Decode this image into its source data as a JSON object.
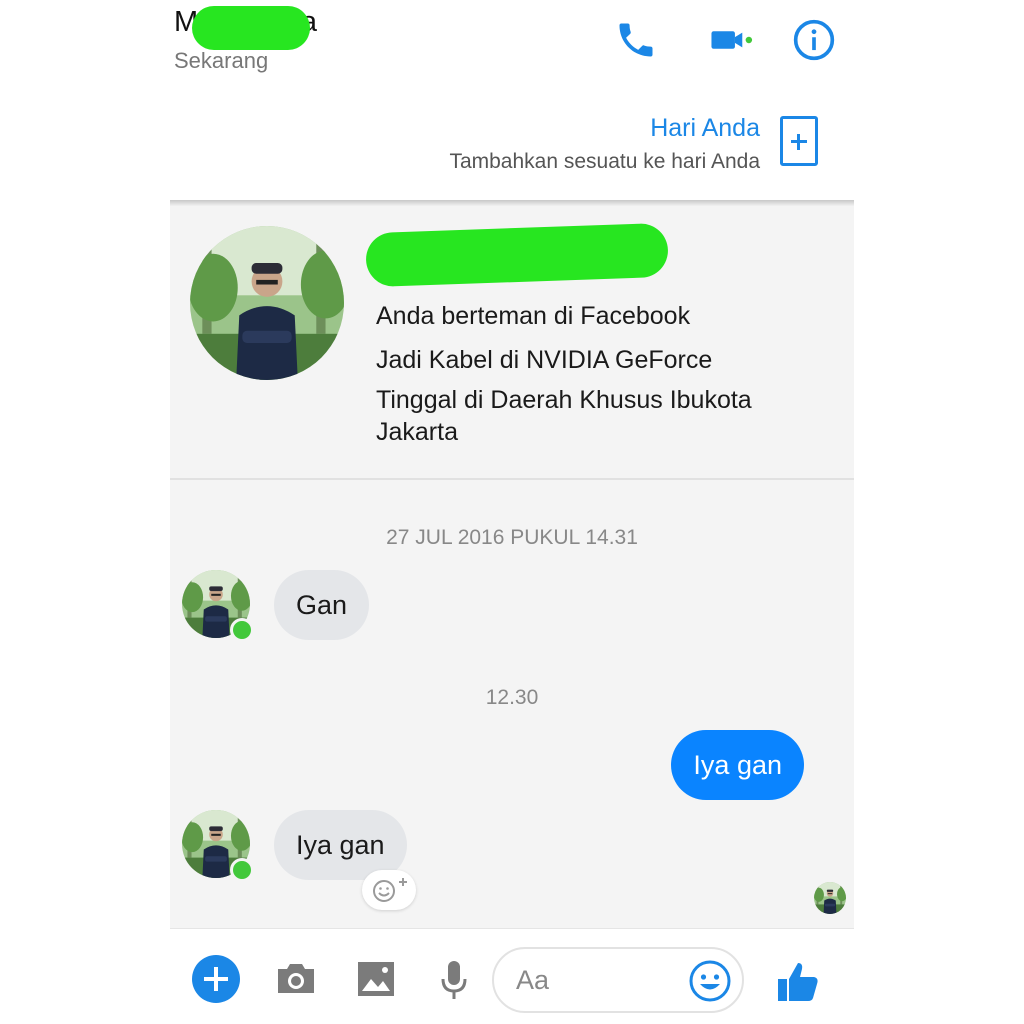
{
  "header": {
    "name": "M          na",
    "status": "Sekarang",
    "icons": [
      "phone-icon",
      "video-call-icon",
      "info-icon"
    ],
    "accent": "#1b87e6",
    "online_dot": "#42c83b",
    "redaction_color": "#27e620"
  },
  "day": {
    "title": "Hari Anda",
    "subtitle": "Tambahkan sesuatu ke hari Anda",
    "icon": "add-story-icon"
  },
  "profile": {
    "line1": "Anda berteman di Facebook",
    "line2": "Jadi Kabel di NVIDIA GeForce",
    "line3": "Tinggal di Daerah Khusus Ibukota Jakarta"
  },
  "messages": [
    {
      "type": "timestamp",
      "text": "27 JUL 2016 PUKUL 14.31"
    },
    {
      "type": "incoming",
      "text": "Gan"
    },
    {
      "type": "timestamp",
      "text": "12.30"
    },
    {
      "type": "outgoing",
      "text": "Iya gan"
    },
    {
      "type": "incoming",
      "text": "Iya gan"
    }
  ],
  "composer": {
    "placeholder": "Aa",
    "icons": [
      "plus-icon",
      "camera-icon",
      "image-icon",
      "microphone-icon",
      "emoji-icon",
      "thumbs-up-icon"
    ],
    "bubble_out_color": "#0a84ff",
    "bubble_in_color": "#e4e6e9"
  }
}
